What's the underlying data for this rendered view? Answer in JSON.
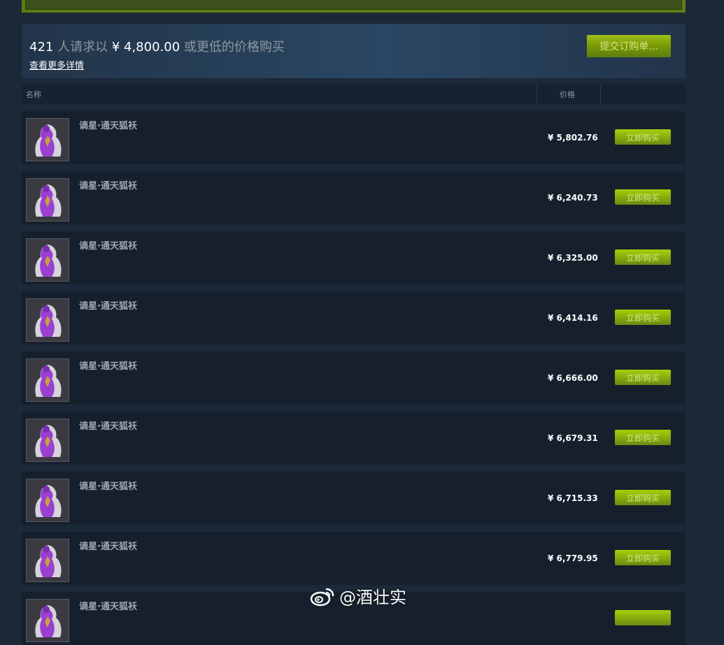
{
  "buy_order": {
    "count": "421",
    "mid_text": "人请求以",
    "price": "¥ 4,800.00",
    "tail_text": "或更低的价格购买",
    "more_link": "查看更多详情",
    "submit_label": "提交订购单..."
  },
  "table": {
    "col_name": "名称",
    "col_price": "价格"
  },
  "listings": [
    {
      "name": "谪星·通天狐袄",
      "price": "¥ 5,802.76",
      "buy_label": "立即购买"
    },
    {
      "name": "谪星·通天狐袄",
      "price": "¥ 6,240.73",
      "buy_label": "立即购买"
    },
    {
      "name": "谪星·通天狐袄",
      "price": "¥ 6,325.00",
      "buy_label": "立即购买"
    },
    {
      "name": "谪星·通天狐袄",
      "price": "¥ 6,414.16",
      "buy_label": "立即购买"
    },
    {
      "name": "谪星·通天狐袄",
      "price": "¥ 6,666.00",
      "buy_label": "立即购买"
    },
    {
      "name": "谪星·通天狐袄",
      "price": "¥ 6,679.31",
      "buy_label": "立即购买"
    },
    {
      "name": "谪星·通天狐袄",
      "price": "¥ 6,715.33",
      "buy_label": "立即购买"
    },
    {
      "name": "谪星·通天狐袄",
      "price": "¥ 6,779.95",
      "buy_label": "立即购买"
    },
    {
      "name": "谪星·通天狐袄",
      "price": "",
      "buy_label": ""
    }
  ],
  "watermark": {
    "icon": "weibo-icon",
    "text": "@酒壮实"
  },
  "colors": {
    "background": "#1b2838",
    "button_green": "#799905",
    "button_text": "#d2e885",
    "muted_text": "#8f98a0"
  }
}
